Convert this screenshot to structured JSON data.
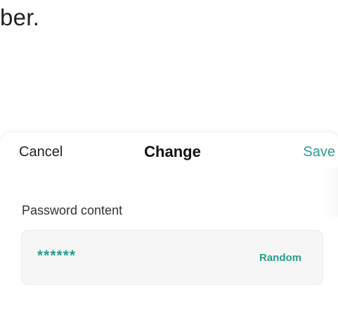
{
  "background": {
    "partial_text": "ber."
  },
  "dialog": {
    "cancel_label": "Cancel",
    "title": "Change",
    "save_label": "Save",
    "field_label": "Password content",
    "password_value": "******",
    "random_label": "Random"
  },
  "colors": {
    "accent": "#2a9d8f",
    "field_background": "#f6f6f6"
  }
}
